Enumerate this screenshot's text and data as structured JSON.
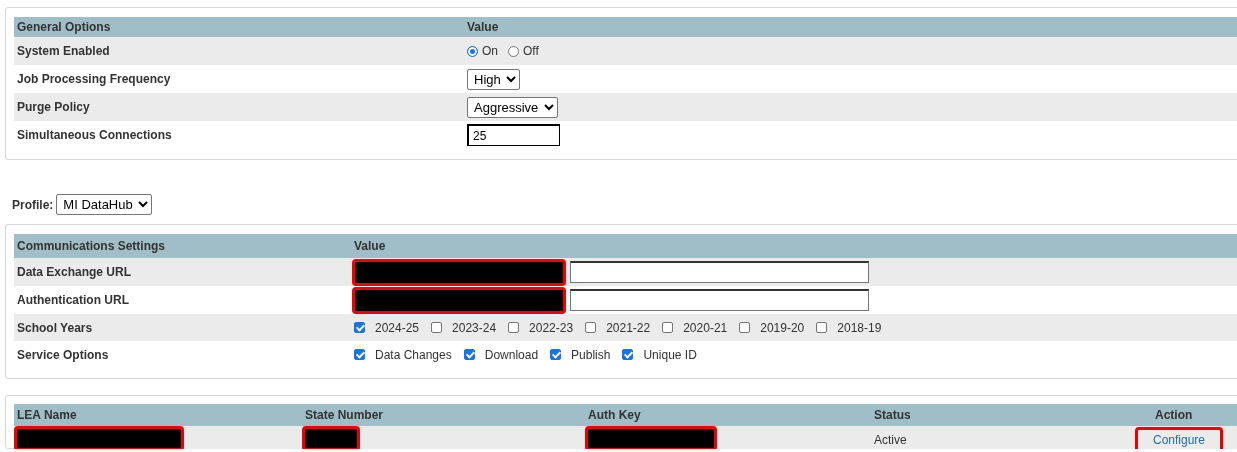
{
  "general_options": {
    "columns": [
      "General Options",
      "Value"
    ],
    "rows": [
      {
        "label": "System Enabled",
        "kind": "radio",
        "options": [
          {
            "label": "On",
            "selected": true
          },
          {
            "label": "Off",
            "selected": false
          }
        ]
      },
      {
        "label": "Job Processing Frequency",
        "kind": "select",
        "value": "High"
      },
      {
        "label": "Purge Policy",
        "kind": "select",
        "value": "Aggressive"
      },
      {
        "label": "Simultaneous Connections",
        "kind": "text",
        "value": "25"
      }
    ]
  },
  "profile": {
    "label": "Profile:",
    "value": "MI DataHub"
  },
  "communications_settings": {
    "columns": [
      "Communications Settings",
      "Value"
    ],
    "rows": [
      {
        "label": "Data Exchange URL",
        "kind": "url",
        "redacted": true
      },
      {
        "label": "Authentication URL",
        "kind": "url",
        "redacted": true
      },
      {
        "label": "School Years",
        "kind": "checkboxes",
        "options": [
          {
            "label": "2024-25",
            "checked": true
          },
          {
            "label": "2023-24",
            "checked": false
          },
          {
            "label": "2022-23",
            "checked": false
          },
          {
            "label": "2021-22",
            "checked": false
          },
          {
            "label": "2020-21",
            "checked": false
          },
          {
            "label": "2019-20",
            "checked": false
          },
          {
            "label": "2018-19",
            "checked": false
          }
        ]
      },
      {
        "label": "Service Options",
        "kind": "checkboxes",
        "options": [
          {
            "label": "Data Changes",
            "checked": true
          },
          {
            "label": "Download",
            "checked": true
          },
          {
            "label": "Publish",
            "checked": true
          },
          {
            "label": "Unique ID",
            "checked": true
          }
        ]
      }
    ]
  },
  "leas": {
    "columns": [
      "LEA Name",
      "State Number",
      "Auth Key",
      "Status",
      "Action"
    ],
    "rows": [
      {
        "cells": [
          {
            "kind": "redacted"
          },
          {
            "kind": "redacted"
          },
          {
            "kind": "redacted"
          },
          {
            "kind": "text",
            "text": "Active"
          },
          {
            "kind": "link",
            "text": "Configure",
            "highlighted": true
          }
        ]
      }
    ]
  }
}
